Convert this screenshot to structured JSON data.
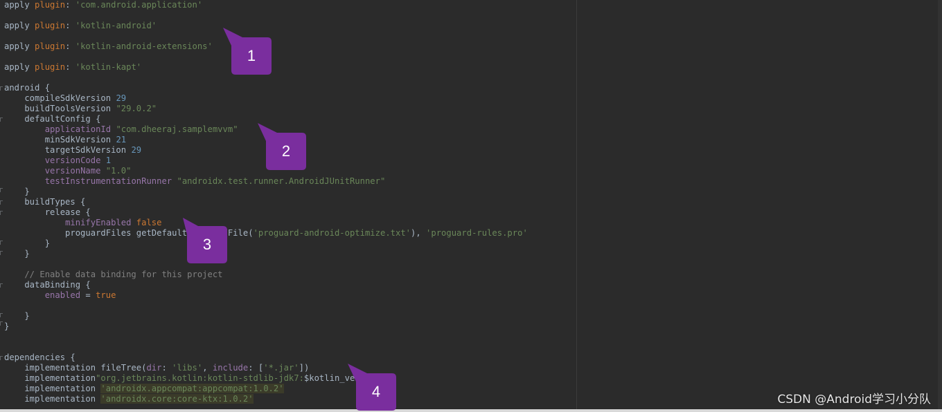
{
  "editor": {
    "lines": [
      {
        "segs": [
          {
            "t": "apply ",
            "c": ""
          },
          {
            "t": "plugin",
            "c": "kw2"
          },
          {
            "t": ": ",
            "c": ""
          },
          {
            "t": "'com.android.application'",
            "c": "str"
          }
        ]
      },
      {
        "segs": [
          {
            "t": "apply ",
            "c": ""
          },
          {
            "t": "plugin",
            "c": "kw2"
          },
          {
            "t": ": ",
            "c": ""
          },
          {
            "t": "'kotlin-android'",
            "c": "str"
          }
        ]
      },
      {
        "segs": [
          {
            "t": "apply ",
            "c": ""
          },
          {
            "t": "plugin",
            "c": "kw2"
          },
          {
            "t": ": ",
            "c": ""
          },
          {
            "t": "'kotlin-android-extensions'",
            "c": "str"
          }
        ]
      },
      {
        "segs": [
          {
            "t": "apply ",
            "c": ""
          },
          {
            "t": "plugin",
            "c": "kw2"
          },
          {
            "t": ": ",
            "c": ""
          },
          {
            "t": "'kotlin-kapt'",
            "c": "str"
          }
        ]
      },
      {
        "segs": [
          {
            "t": "android {",
            "c": ""
          }
        ]
      },
      {
        "segs": [
          {
            "t": "    compileSdkVersion ",
            "c": ""
          },
          {
            "t": "29",
            "c": "num"
          }
        ]
      },
      {
        "segs": [
          {
            "t": "    buildToolsVersion ",
            "c": ""
          },
          {
            "t": "\"29.0.2\"",
            "c": "str"
          }
        ]
      },
      {
        "segs": [
          {
            "t": "    defaultConfig {",
            "c": ""
          }
        ]
      },
      {
        "segs": [
          {
            "t": "        ",
            "c": ""
          },
          {
            "t": "applicationId",
            "c": "prop"
          },
          {
            "t": " ",
            "c": ""
          },
          {
            "t": "\"com.dheeraj.samplemvvm\"",
            "c": "str"
          }
        ]
      },
      {
        "segs": [
          {
            "t": "        minSdkVersion ",
            "c": ""
          },
          {
            "t": "21",
            "c": "num"
          }
        ]
      },
      {
        "segs": [
          {
            "t": "        targetSdkVersion ",
            "c": ""
          },
          {
            "t": "29",
            "c": "num"
          }
        ]
      },
      {
        "segs": [
          {
            "t": "        ",
            "c": ""
          },
          {
            "t": "versionCode",
            "c": "prop"
          },
          {
            "t": " ",
            "c": ""
          },
          {
            "t": "1",
            "c": "num"
          }
        ]
      },
      {
        "segs": [
          {
            "t": "        ",
            "c": ""
          },
          {
            "t": "versionName",
            "c": "prop"
          },
          {
            "t": " ",
            "c": ""
          },
          {
            "t": "\"1.0\"",
            "c": "str"
          }
        ]
      },
      {
        "segs": [
          {
            "t": "        ",
            "c": ""
          },
          {
            "t": "testInstrumentationRunner",
            "c": "prop"
          },
          {
            "t": " ",
            "c": ""
          },
          {
            "t": "\"androidx.test.runner.AndroidJUnitRunner\"",
            "c": "str"
          }
        ]
      },
      {
        "segs": [
          {
            "t": "    }",
            "c": ""
          }
        ]
      },
      {
        "segs": [
          {
            "t": "    buildTypes {",
            "c": ""
          }
        ]
      },
      {
        "segs": [
          {
            "t": "        release {",
            "c": ""
          }
        ]
      },
      {
        "segs": [
          {
            "t": "            ",
            "c": ""
          },
          {
            "t": "minifyEnabled",
            "c": "prop"
          },
          {
            "t": " ",
            "c": ""
          },
          {
            "t": "false",
            "c": "kw"
          }
        ]
      },
      {
        "segs": [
          {
            "t": "            proguardFiles getDefaultProguardFile(",
            "c": ""
          },
          {
            "t": "'proguard-android-optimize.txt'",
            "c": "str"
          },
          {
            "t": "), ",
            "c": ""
          },
          {
            "t": "'proguard-rules.pro'",
            "c": "str"
          }
        ]
      },
      {
        "segs": [
          {
            "t": "        }",
            "c": ""
          }
        ]
      },
      {
        "segs": [
          {
            "t": "    }",
            "c": ""
          }
        ]
      },
      {
        "segs": [
          {
            "t": "    // Enable data binding for this project",
            "c": "cmt"
          }
        ]
      },
      {
        "segs": [
          {
            "t": "    dataBinding {",
            "c": ""
          }
        ]
      },
      {
        "segs": [
          {
            "t": "        ",
            "c": ""
          },
          {
            "t": "enabled",
            "c": "prop"
          },
          {
            "t": " = ",
            "c": ""
          },
          {
            "t": "true",
            "c": "kw"
          }
        ]
      },
      {
        "segs": [
          {
            "t": "    }",
            "c": ""
          }
        ]
      },
      {
        "segs": [
          {
            "t": "}",
            "c": ""
          }
        ]
      },
      {
        "segs": [
          {
            "t": "dependencies {",
            "c": ""
          }
        ]
      },
      {
        "segs": [
          {
            "t": "    implementation fileTree(",
            "c": ""
          },
          {
            "t": "dir",
            "c": "prop"
          },
          {
            "t": ": ",
            "c": ""
          },
          {
            "t": "'libs'",
            "c": "str"
          },
          {
            "t": ", ",
            "c": ""
          },
          {
            "t": "include",
            "c": "prop"
          },
          {
            "t": ": [",
            "c": ""
          },
          {
            "t": "'*.jar'",
            "c": "str"
          },
          {
            "t": "])",
            "c": ""
          }
        ]
      },
      {
        "segs": [
          {
            "t": "    implementation",
            "c": ""
          },
          {
            "t": "\"org.jetbrains.kotlin:kotlin-stdlib-jdk7:",
            "c": "str"
          },
          {
            "t": "$kotlin_version",
            "c": ""
          },
          {
            "t": "\"",
            "c": "str"
          }
        ]
      },
      {
        "segs": [
          {
            "t": "    implementation ",
            "c": ""
          },
          {
            "t": "'androidx.appcompat:appcompat:1.0.2'",
            "c": "str hl"
          }
        ]
      },
      {
        "segs": [
          {
            "t": "    implementation ",
            "c": ""
          },
          {
            "t": "'androidx.core:core-ktx:1.0.2'",
            "c": "str hl"
          }
        ]
      }
    ]
  },
  "callouts": [
    {
      "label": "1"
    },
    {
      "label": "2"
    },
    {
      "label": "3"
    },
    {
      "label": "4"
    }
  ],
  "colors": {
    "callout": "#7a2e9e",
    "background": "#2b2b2b"
  },
  "watermark": "CSDN @Android学习小分队"
}
